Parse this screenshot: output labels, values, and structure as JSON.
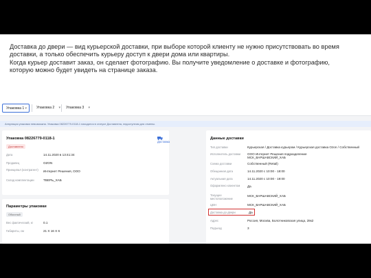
{
  "caption": {
    "line1": "Доставка до двери — вид курьерской доставки, при выборе которой клиенту не нужно присутствовать во время доставки, а только обеспечить курьеру доступ к двери дома или квартиры.",
    "line2": "Когда курьер доставит заказ, он сделает фотографию. Вы получите уведомление о доставке и фотографию, которую можно будет увидеть на странице заказа."
  },
  "tabs": [
    {
      "label": "Упаковка 1"
    },
    {
      "label": "Упаковка 2"
    },
    {
      "label": "Упаковка 3"
    }
  ],
  "notice": "Аннуляция упаковки невозможна. Упаковка 08226779-0118-1 находится в статусе Доставлена, недоступном для отмены.",
  "package": {
    "title": "Упаковка 08226779-0118-1",
    "badge": "Доставлено",
    "action": "Доставка",
    "rows": [
      {
        "label": "Дата",
        "value": "14.11.2020 в 13:41:34"
      },
      {
        "label": "Продавец",
        "value": "OZON"
      },
      {
        "label": "Принципал (контрагент)",
        "value": "Интернет Решения, ООО"
      },
      {
        "label": "Склад комплектации",
        "value": "ТВЕРЬ_ХАБ"
      }
    ]
  },
  "params": {
    "title": "Параметры упаковки",
    "badge": "Обычный",
    "rows": [
      {
        "label": "Вес фактический, кг",
        "value": "0.1"
      },
      {
        "label": "Габариты, см",
        "value": "21 Х 16 Х 6"
      }
    ]
  },
  "delivery": {
    "title": "Данные доставки",
    "rows": [
      {
        "label": "Тип доставки",
        "value": "Курьерская / Доставка курьером / Курьерская доставка Ozon / Собственный"
      },
      {
        "label": "Исполнитель доставки",
        "value": "ООО Интернет Решения подразделение МСК_ВАРШАВСКИЙ_ХАБ"
      },
      {
        "label": "Схема доставки",
        "value": "Собственный (Retail)"
      },
      {
        "label": "Обещанная дата",
        "value": "14.11.2020 с 10:00 - 18:00"
      },
      {
        "label": "Актуальная дата",
        "value": "14.11.2020 с 10:00 - 19:00"
      },
      {
        "label": "Оформлено клиентом",
        "value": "Да"
      },
      {
        "label": "Текущее местоположение",
        "value": "МСК_ВАРШАВСКИЙ_ХАБ"
      },
      {
        "label": "ЦВН",
        "value": "МСК_ВАРШАВСКИЙ_ХАБ"
      },
      {
        "label": "Доставка до двери",
        "value": "Да"
      },
      {
        "label": "Адрес",
        "value": "Россия, Москва, Болотниковская улица, 28к2"
      },
      {
        "label": "Подъезд",
        "value": "3"
      }
    ]
  },
  "colors": {
    "accent": "#3b6fd8",
    "highlight": "#d0302f",
    "badge_red": "#c23a3a"
  }
}
